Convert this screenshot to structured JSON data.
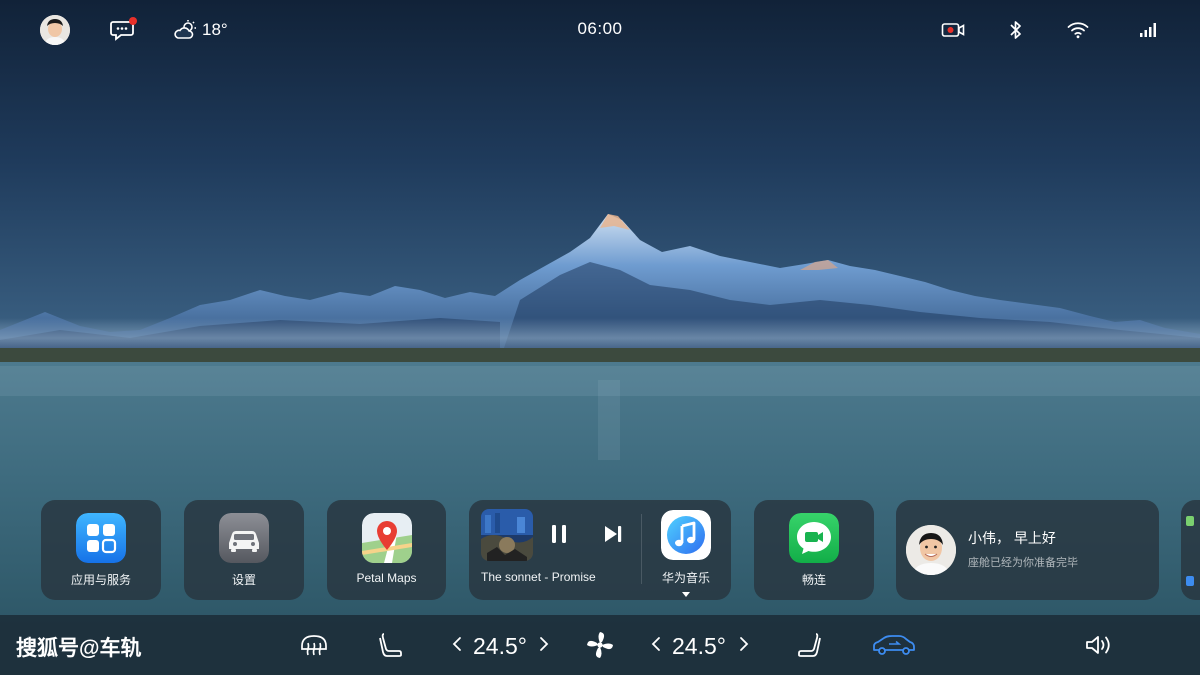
{
  "status_bar": {
    "time": "06:00",
    "weather": {
      "temperature": "18°",
      "icon": "partly-cloudy-icon"
    },
    "icons": [
      "avatar",
      "message-icon",
      "dashcam-icon",
      "bluetooth-icon",
      "wifi-icon",
      "signal-icon"
    ]
  },
  "dock": {
    "apps": [
      {
        "label": "应用与服务",
        "icon": "apps-services-icon"
      },
      {
        "label": "设置",
        "icon": "car-settings-icon"
      },
      {
        "label": "Petal Maps",
        "icon": "petal-maps-icon"
      }
    ],
    "music": {
      "track": "The sonnet - Promise",
      "app_label": "华为音乐",
      "state": "playing"
    },
    "changlian": {
      "label": "畅连",
      "icon": "changlian-icon"
    },
    "assistant": {
      "greeting": "小伟， 早上好",
      "message": "座舱已经为你准备完毕"
    }
  },
  "control_bar": {
    "watermark": "搜狐号@车轨",
    "driver_temp": "24.5°",
    "passenger_temp": "24.5°"
  },
  "colors": {
    "accent_blue": "#2f8cff",
    "notification_red": "#e8302a",
    "car_icon_active": "#3d8cf0"
  }
}
